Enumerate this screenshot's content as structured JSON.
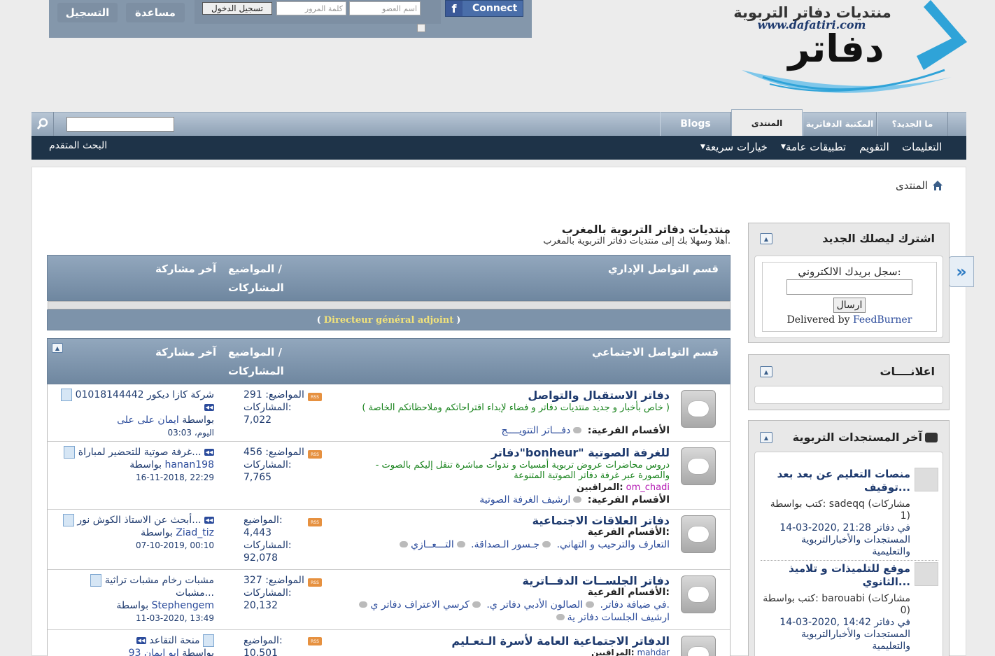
{
  "header": {
    "register": "التسجيل",
    "help": "مساعدة",
    "login_button": "تسجيل الدخول",
    "password_placeholder": "كلمة المرور",
    "username_placeholder": "اسم العضو",
    "facebook": "Connect",
    "logo_title": "منتديات دفاتر التربوية",
    "logo_url": "www.dafatiri.com",
    "logo_word": "دفاتر"
  },
  "nav": {
    "tabs": [
      "Blogs",
      "المنتدى",
      "المكتبة الدفاترية",
      "ما الجديد؟"
    ],
    "sub": {
      "advanced_search": "البحث المتقدم",
      "items": [
        "التعليمات",
        "التقويم",
        "تطبيقات عامة",
        "خيارات سريعة"
      ]
    }
  },
  "breadcrumb": "المنتدى",
  "main": {
    "title": "منتديات دفاتر التربوية بالمغرب",
    "welcome": "أهلا وسهلا بك إلى منتديات دفاتر التربوية بالمغرب.",
    "col_topics": "المواضيع /",
    "col_posts": "المشاركات",
    "col_last": "آخر مشاركة",
    "admin_section": {
      "title": "قسم التواصل الإداري",
      "footer_paren_open": "(",
      "footer_name": "Directeur général adjoint",
      "footer_paren_close": ")"
    },
    "social_section": {
      "title": "قسم التواصل الاجتماعي"
    },
    "labels": {
      "subforums": "الأقسام الفرعية:",
      "moderators": "المراقبين:",
      "topics": "المواضيع:",
      "posts": "المشاركات:",
      "by": "بواسطة"
    },
    "forums": [
      {
        "name": "دفاتر الاستقبال والتواصل",
        "desc": "( خاص بأخبار و جديد منتديات دفاتر و فضاء لإبداء اقتراحاتكم وملاحظاتكم الخاصة )",
        "subforums": "دفـــاتر التتويــــج",
        "topics": "291",
        "posts": "7,022",
        "last_title": "شركة كازا ديكور 01018144442",
        "last_by": "ايمان على على",
        "last_date": "اليوم، 03:03"
      },
      {
        "name": "دفاتر\"bonheur\" للغرفة الصوتية",
        "desc": "- دروس محاضرات عروض تربوية أمسيات و ندوات مباشرة تنقل إليكم بالصوت والصورة عبر غرفة دفاتر الصوتية المتنوعة",
        "moderator": "om_chadi",
        "subforums": "ارشيف الغرفة الصوتية",
        "topics": "456",
        "posts": "7,765",
        "last_title": "غرفة صوتية للتحضير لمباراة...",
        "last_by": "hanan198",
        "last_date": "16-11-2018, 22:29"
      },
      {
        "name": "دفاتر العلاقات الاجتماعية",
        "subforums_list": [
          "التعارف والترحيب و التهاني.",
          "جـسور الـصداقة.",
          "التـــعــازي"
        ],
        "topics": "4,443",
        "posts": "92,078",
        "last_title": "أبحث عن الاستاذ الكوش نور...",
        "last_by": "Ziad_tiz",
        "last_date": "07-10-2019, 00:10"
      },
      {
        "name": "دفاتر الجلســات الدفــاترية",
        "subforums_list": [
          "في ضيافة دفاتر.",
          "الصالون الأدبي دفاتر ي.",
          "كرسي الاعتراف دفاتر ي."
        ],
        "subforums_extra": "ارشيف الجلسات دفاتر ية",
        "topics": "327",
        "posts": "20,132",
        "last_title": "مشبات رخام مشبات تراثية مشبات...",
        "last_by": "Stephengem",
        "last_date": "11-03-2020, 13:49"
      },
      {
        "name": "الدفاتر الاجتماعية العامة لأسرة الـتعـليم",
        "moderator": "mahdar",
        "topics": "10,501",
        "last_title": "منحة التقاعد",
        "last_by": "ابو ايمان 93"
      }
    ]
  },
  "sidebar": {
    "subscribe": {
      "title": "اشترك ليصلك الجديد",
      "label": "سجل بريدك الالكتروني:",
      "button": "ارسال",
      "delivered": "Delivered by",
      "feedburner": "FeedBurner"
    },
    "ads": {
      "title": "اعلانــــات"
    },
    "latest": {
      "title": "آخر المستجدات التربوية",
      "posts": [
        {
          "title": "منصات التعليم عن بعد بعد توقيف...",
          "by_label": "كتب بواسطة:",
          "author": "sadeqq",
          "replies": "(مشاركات 1)",
          "date": "14-03-2020, 21:28 في",
          "forum": "دفاتر المستجدات والأخبارالتربوية والتعليمية"
        },
        {
          "title": "موقع للتلميذات و تلاميذ الثانوي...",
          "by_label": "كتب بواسطة:",
          "author": "barouabi",
          "replies": "(مشاركات 0)",
          "date": "14-03-2020, 14:42 في",
          "forum": "دفاتر المستجدات والأخبارالتربوية والتعليمية"
        }
      ]
    }
  }
}
